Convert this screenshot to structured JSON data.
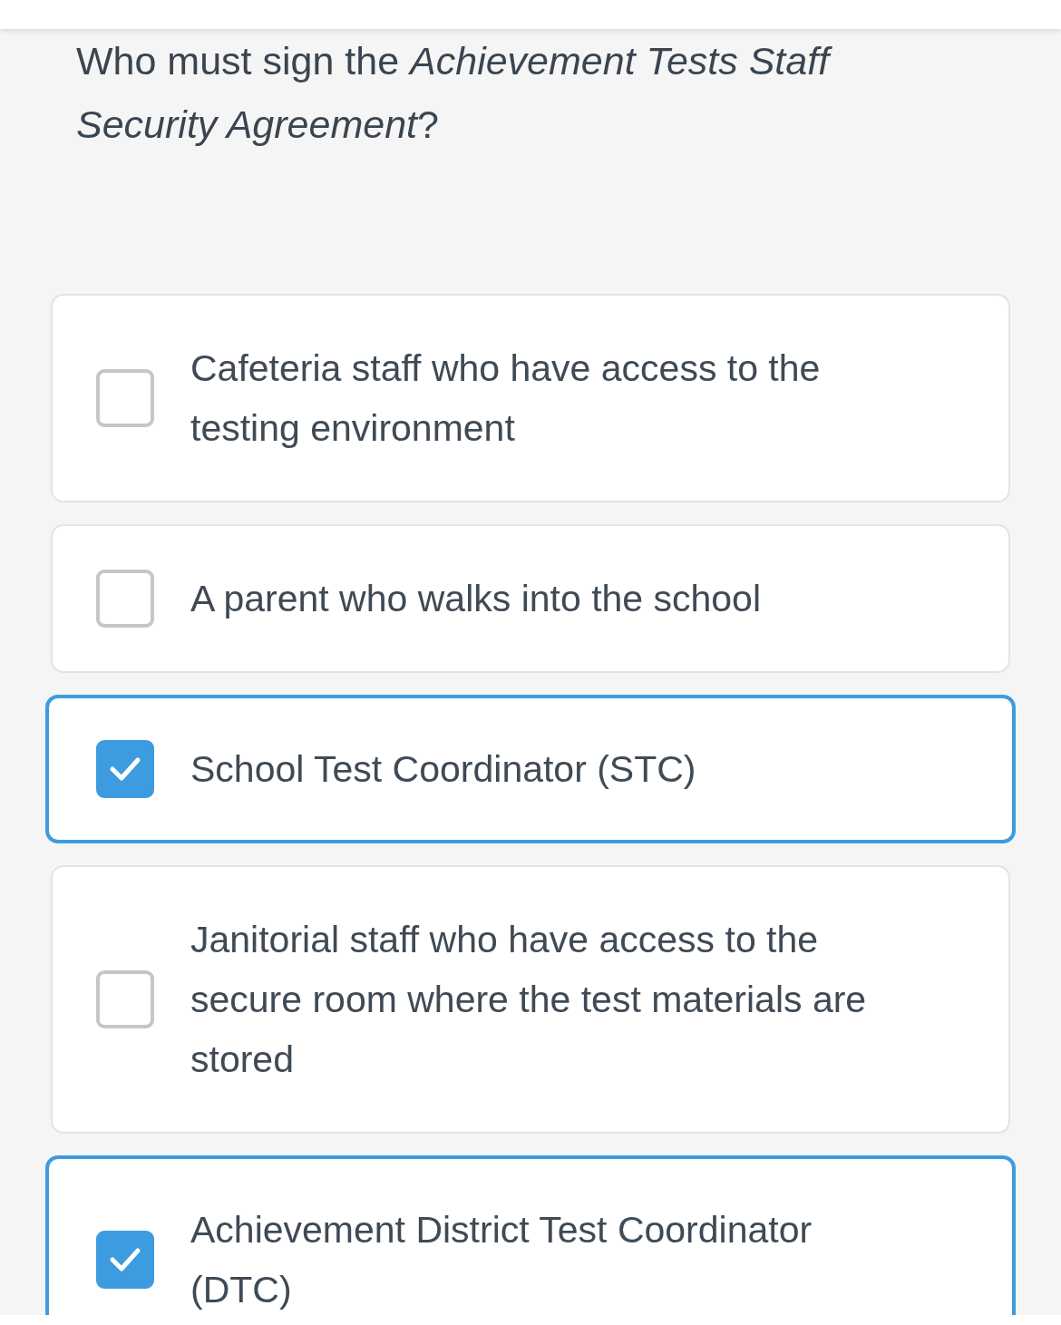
{
  "question": "Who must sign the *Achievement Tests Staff Security Agreement*?",
  "options": [
    {
      "label": "Cafeteria staff who have access to the testing environment",
      "checked": false
    },
    {
      "label": "A parent who walks into the school",
      "checked": false
    },
    {
      "label": "School Test Coordinator (STC)",
      "checked": true
    },
    {
      "label": "Janitorial staff who have access to the secure room where the test materials are stored",
      "checked": false
    },
    {
      "label": "Achievement District Test Coordinator (DTC)",
      "checked": true
    }
  ]
}
